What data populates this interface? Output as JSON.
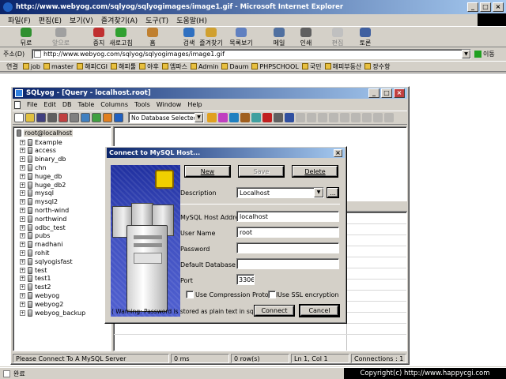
{
  "ie": {
    "title": "http://www.webyog.com/sqlyog/sqlyogimages/image1.gif - Microsoft Internet Explorer",
    "menu": [
      "파일(F)",
      "편집(E)",
      "보기(V)",
      "즐겨찾기(A)",
      "도구(T)",
      "도움말(H)"
    ],
    "toolbar": [
      {
        "label": "뒤로",
        "icon": "back-arrow-icon"
      },
      {
        "label": "앞으로",
        "icon": "forward-arrow-icon"
      },
      {
        "label": "중지",
        "icon": "stop-icon"
      },
      {
        "label": "새로고침",
        "icon": "refresh-icon"
      },
      {
        "label": "홈",
        "icon": "home-icon"
      },
      {
        "label": "검색",
        "icon": "search-icon"
      },
      {
        "label": "즐겨찾기",
        "icon": "favorites-icon"
      },
      {
        "label": "목록보기",
        "icon": "history-icon"
      },
      {
        "label": "메일",
        "icon": "mail-icon"
      },
      {
        "label": "인쇄",
        "icon": "print-icon"
      },
      {
        "label": "편집",
        "icon": "edit-icon"
      },
      {
        "label": "토론",
        "icon": "discuss-icon"
      }
    ],
    "address_label": "주소(D)",
    "address_value": "http://www.webyog.com/sqlyog/sqlyogimages/image1.gif",
    "go_label": "이동",
    "links_label": "연결",
    "links": [
      "job",
      "master",
      "해피CGI",
      "해피툴",
      "야후",
      "엠파스",
      "Admin",
      "Daum",
      "PHPSCHOOL",
      "국민",
      "해피부동산",
      "장수항"
    ],
    "status": "완료",
    "copyright": "Copyright(c) http://www.happycgi.com"
  },
  "sqlyog": {
    "title": "SQLyog - [Query - localhost.root]",
    "menu": [
      "File",
      "Edit",
      "DB",
      "Table",
      "Columns",
      "Tools",
      "Window",
      "Help"
    ],
    "db_select": "No Database Selected",
    "tree_root": "root@localhost",
    "databases": [
      "Example",
      "access",
      "binary_db",
      "chn",
      "huge_db",
      "huge_db2",
      "mysql",
      "mysql2",
      "north-wind",
      "northwind",
      "odbc_test",
      "pubs",
      "rnadhani",
      "rohit",
      "sqlyogisfast",
      "test",
      "test1",
      "test2",
      "webyog",
      "webyog2",
      "webyog_backup"
    ],
    "status": {
      "message": "Please Connect To A MySQL Server",
      "time": "0 ms",
      "rows": "0 row(s)",
      "position": "Ln 1, Col 1",
      "connections": "Connections : 1"
    }
  },
  "dialog": {
    "title": "Connect to MySQL Host...",
    "new_label": "New",
    "save_label": "Save",
    "delete_label": "Delete",
    "description_label": "Description",
    "description_value": "Localhost",
    "browse_label": "...",
    "host_label": "MySQL Host Address",
    "host_value": "localhost",
    "user_label": "User Name",
    "user_value": "root",
    "password_label": "Password",
    "password_value": "",
    "default_db_label": "Default Database",
    "default_db_value": "",
    "port_label": "Port",
    "port_value": "3306",
    "compression_label": "Use Compression Protocol",
    "ssl_label": "Use SSL encryption",
    "warning": "( Warning: Password is stored as plain text in sqlyog.ini )",
    "connect_label": "Connect",
    "cancel_label": "Cancel"
  },
  "colors": {
    "titlebar_start": "#0a246a",
    "titlebar_end": "#a6caf0",
    "window_bg": "#d4d0c8"
  }
}
